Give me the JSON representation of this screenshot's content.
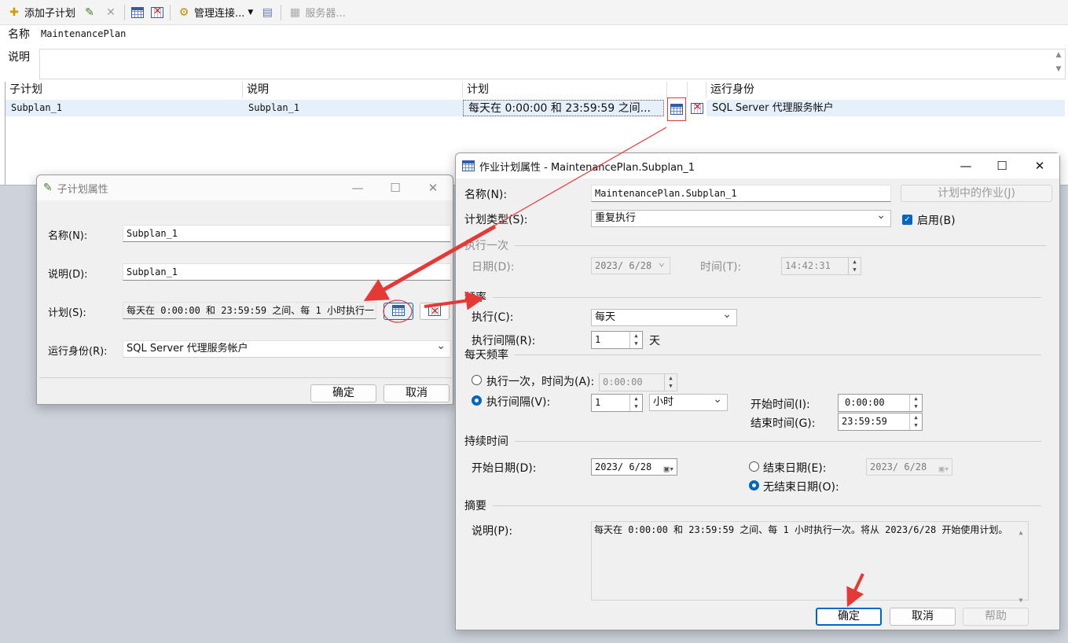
{
  "toolbar": {
    "add_subplan": "添加子计划",
    "manage_connections": "管理连接...",
    "servers": "服务器..."
  },
  "plan": {
    "name_label": "名称",
    "name_value": "MaintenancePlan",
    "desc_label": "说明"
  },
  "grid": {
    "headers": [
      "子计划",
      "说明",
      "计划",
      "运行身份"
    ],
    "row": {
      "subplan": "Subplan_1",
      "description": "Subplan_1",
      "schedule": "每天在 0:00:00 和 23:59:59 之间...",
      "run_as": "SQL Server 代理服务帐户"
    }
  },
  "subplan_dialog": {
    "title": "子计划属性",
    "name_label": "名称(N):",
    "name_value": "Subplan_1",
    "desc_label": "说明(D):",
    "desc_value": "Subplan_1",
    "schedule_label": "计划(S):",
    "schedule_value": "每天在 0:00:00 和 23:59:59 之间、每 1 小时执行一",
    "runas_label": "运行身份(R):",
    "runas_value": "SQL Server 代理服务帐户",
    "ok": "确定",
    "cancel": "取消"
  },
  "job_dialog": {
    "title": "作业计划属性 - MaintenancePlan.Subplan_1",
    "name_label": "名称(N):",
    "name_value": "MaintenancePlan.Subplan_1",
    "jobs_in_schedule": "计划中的作业(J)",
    "type_label": "计划类型(S):",
    "type_value": "重复执行",
    "enabled_label": "启用(B)",
    "once_section": "执行一次",
    "once_date_label": "日期(D):",
    "once_date_value": "2023/ 6/28",
    "once_time_label": "时间(T):",
    "once_time_value": "14:42:31",
    "freq_section": "频率",
    "occurs_label": "执行(C):",
    "occurs_value": "每天",
    "recurs_label": "执行间隔(R):",
    "recurs_value": "1",
    "recurs_unit": "天",
    "daily_section": "每天频率",
    "daily_once_label": "执行一次，时间为(A):",
    "daily_once_value": "0:00:00",
    "daily_every_label": "执行间隔(V):",
    "daily_every_value": "1",
    "daily_every_unit": "小时",
    "start_time_label": "开始时间(I):",
    "start_time_value": "0:00:00",
    "end_time_label": "结束时间(G):",
    "end_time_value": "23:59:59",
    "duration_section": "持续时间",
    "start_date_label": "开始日期(D):",
    "start_date_value": "2023/ 6/28",
    "end_date_label": "结束日期(E):",
    "end_date_value": "2023/ 6/28",
    "no_end_label": "无结束日期(O):",
    "summary_section": "摘要",
    "summary_desc_label": "说明(P):",
    "summary_text": "每天在 0:00:00 和 23:59:59 之间、每 1 小时执行一次。将从 2023/6/28 开始使用计划。",
    "ok": "确定",
    "cancel": "取消",
    "help": "帮助"
  },
  "colors": {
    "annotation": "#e53935",
    "accent": "#0067c0",
    "selected_row": "#e6f0fa"
  }
}
